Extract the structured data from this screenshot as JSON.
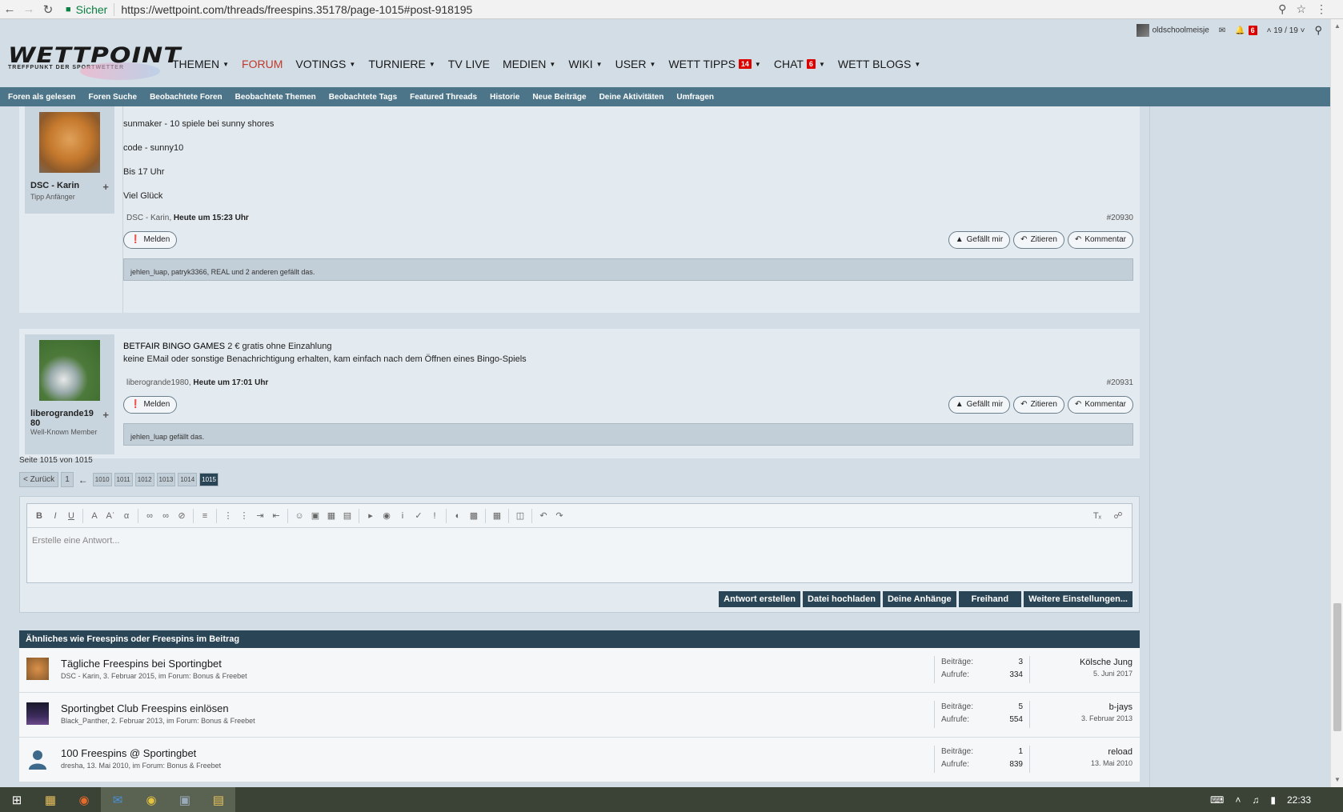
{
  "browser": {
    "secure_label": "Sicher",
    "url": "https://wettpoint.com/threads/freespins.35178/page-1015#post-918195"
  },
  "header": {
    "logo_text": "WETTPOINT",
    "logo_sub": "TREFFPUNKT DER SPORTWETTER",
    "nav": [
      {
        "label": "THEMEN",
        "caret": true
      },
      {
        "label": "FORUM",
        "caret": false,
        "active": true
      },
      {
        "label": "VOTINGS",
        "caret": true
      },
      {
        "label": "TURNIERE",
        "caret": true
      },
      {
        "label": "TV LIVE",
        "caret": false
      },
      {
        "label": "MEDIEN",
        "caret": true
      },
      {
        "label": "WIKI",
        "caret": true
      },
      {
        "label": "USER",
        "caret": true
      },
      {
        "label": "WETT TIPPS",
        "caret": true,
        "badge": "14"
      },
      {
        "label": "CHAT",
        "caret": true,
        "badge": "6"
      },
      {
        "label": "WETT BLOGS",
        "caret": true
      }
    ],
    "username": "oldschoolmeisje",
    "alerts_badge": "6",
    "page_counter": "19 / 19"
  },
  "subnav": [
    "Foren als gelesen",
    "Foren Suche",
    "Beobachtete Foren",
    "Beobachtete Themen",
    "Beobachtete Tags",
    "Featured Threads",
    "Historie",
    "Neue Beiträge",
    "Deine Aktivitäten",
    "Umfragen"
  ],
  "posts": [
    {
      "author": "DSC - Karin",
      "author_title": "Tipp Anfänger",
      "lines": [
        "sunmaker - 10 spiele bei sunny shores",
        "code - sunny10",
        "Bis 17 Uhr",
        "Viel Glück"
      ],
      "meta_author": "DSC - Karin,",
      "meta_time": "Heute um 15:23 Uhr",
      "post_no": "#20930",
      "likes": "jehlen_luap, patryk3366, REAL und 2 anderen gefällt das."
    },
    {
      "author_l1": "liberogrande19",
      "author_l2": "80",
      "author_title": "Well-Known Member",
      "title_bold": "BETFAIR BINGO GAMES",
      "title_rest": " 2 € gratis ohne Einzahlung",
      "line2": "keine EMail oder sonstige Benachrichtigung erhalten, kam einfach nach dem Öffnen eines Bingo-Spiels",
      "meta_author": "liberogrande1980,",
      "meta_time": "Heute um 17:01 Uhr",
      "post_no": "#20931",
      "likes": "jehlen_luap gefällt das."
    }
  ],
  "actions": {
    "report": "Melden",
    "like": "Gefällt mir",
    "quote": "Zitieren",
    "comment": "Kommentar"
  },
  "pagination": {
    "info": "Seite 1015 von 1015",
    "back": "< Zurück",
    "first": "1",
    "pages": [
      "1010",
      "1011",
      "1012",
      "1013",
      "1014"
    ],
    "current": "1015"
  },
  "editor": {
    "placeholder": "Erstelle eine Antwort...",
    "buttons": [
      "Antwort erstellen",
      "Datei hochladen",
      "Deine Anhänge",
      "Freihand",
      "Weitere Einstellungen..."
    ]
  },
  "similar": {
    "title": "Ähnliches wie Freespins oder Freespins im Beitrag",
    "posts_label": "Beiträge:",
    "views_label": "Aufrufe:",
    "threads": [
      {
        "title": "Tägliche Freespins bei Sportingbet",
        "sub": "DSC - Karin, 3. Februar 2015, im Forum: Bonus & Freebet",
        "posts": "3",
        "views": "334",
        "last_user": "Kölsche Jung",
        "last_date": "5. Juni 2017"
      },
      {
        "title": "Sportingbet Club Freespins einlösen",
        "sub": "Black_Panther, 2. Februar 2013, im Forum: Bonus & Freebet",
        "posts": "5",
        "views": "554",
        "last_user": "b-jays",
        "last_date": "3. Februar 2013"
      },
      {
        "title": "100 Freespins @ Sportingbet",
        "sub": "dresha, 13. Mai 2010, im Forum: Bonus & Freebet",
        "posts": "1",
        "views": "839",
        "last_user": "reload",
        "last_date": "13. Mai 2010"
      }
    ]
  },
  "taskbar": {
    "clock": "22:33"
  }
}
